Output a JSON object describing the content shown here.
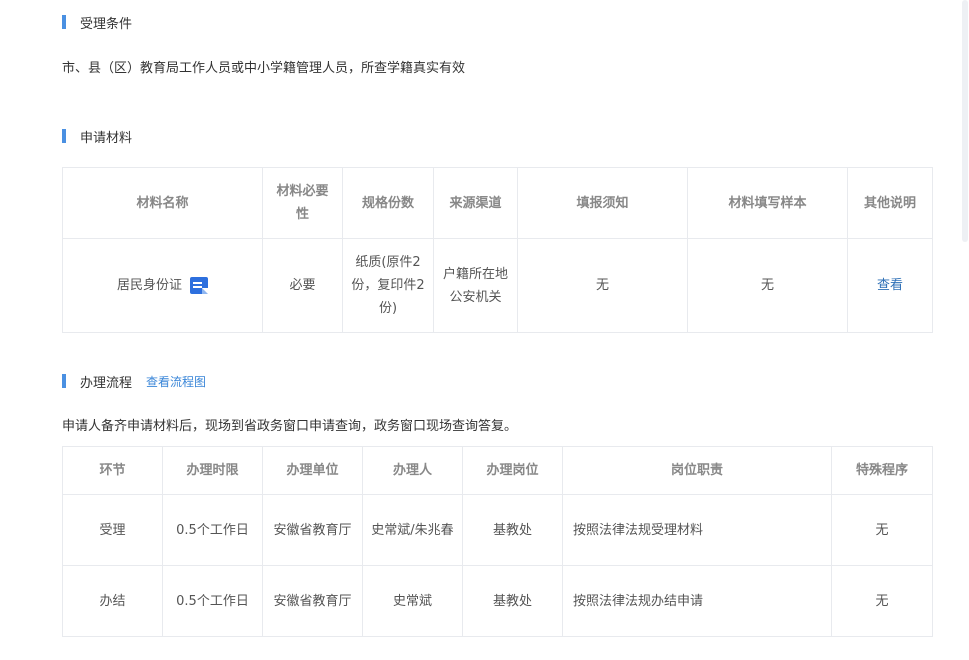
{
  "acceptance": {
    "title": "受理条件",
    "text": "市、县（区）教育局工作人员或中小学籍管理人员，所查学籍真实有效"
  },
  "materials": {
    "title": "申请材料",
    "headers": [
      "材料名称",
      "材料必要性",
      "规格份数",
      "来源渠道",
      "填报须知",
      "材料填写样本",
      "其他说明"
    ],
    "rows": [
      {
        "name": "居民身份证",
        "icon": "document-icon",
        "necessity": "必要",
        "spec": "纸质(原件2份，复印件2份)",
        "source": "户籍所在地公安机关",
        "notice": "无",
        "sample": "无",
        "other": "查看"
      }
    ]
  },
  "process": {
    "title": "办理流程",
    "link": "查看流程图",
    "text": "申请人备齐申请材料后，现场到省政务窗口申请查询，政务窗口现场查询答复。",
    "headers": [
      "环节",
      "办理时限",
      "办理单位",
      "办理人",
      "办理岗位",
      "岗位职责",
      "特殊程序"
    ],
    "rows": [
      {
        "stage": "受理",
        "time": "0.5个工作日",
        "unit": "安徽省教育厅",
        "person": "史常斌/朱兆春",
        "post": "基教处",
        "duty": "按照法律法规受理材料",
        "special": "无"
      },
      {
        "stage": "办结",
        "time": "0.5个工作日",
        "unit": "安徽省教育厅",
        "person": "史常斌",
        "post": "基教处",
        "duty": "按照法律法规办结申请",
        "special": "无"
      }
    ]
  }
}
